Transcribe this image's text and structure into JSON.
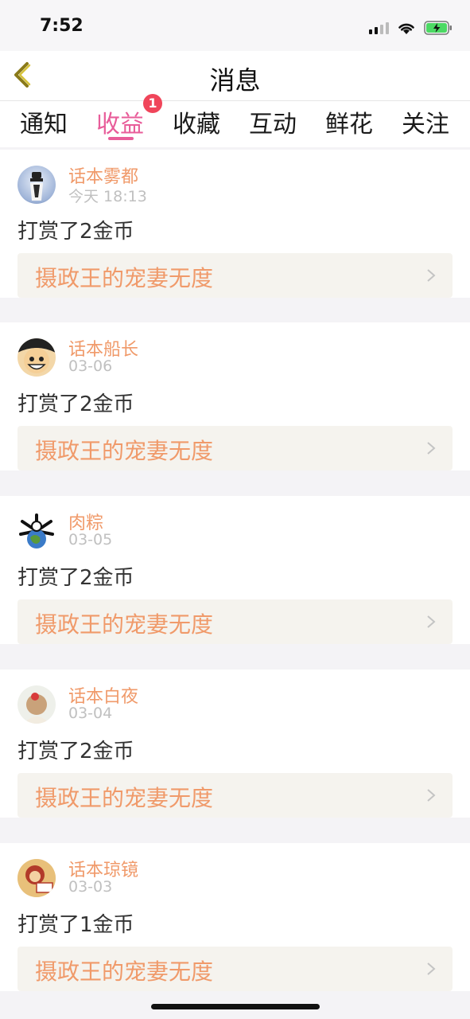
{
  "status": {
    "time": "7:52"
  },
  "nav": {
    "title": "消息"
  },
  "tabs": [
    {
      "label": "通知"
    },
    {
      "label": "收益"
    },
    {
      "label": "收藏"
    },
    {
      "label": "互动"
    },
    {
      "label": "鲜花"
    },
    {
      "label": "关注"
    }
  ],
  "active_tab_badge": "1",
  "colors": {
    "accent": "#e85d9a",
    "name": "#f09a6a",
    "badge": "#f0455a",
    "book_bg": "#f5f3ee"
  },
  "items": [
    {
      "user": "话本雾都",
      "time": "今天 18:13",
      "action": "打赏了2金币",
      "book": "摄政王的宠妻无度",
      "avatar_icon": "avatar-figure-icon"
    },
    {
      "user": "话本船长",
      "time": "03-06",
      "action": "打赏了2金币",
      "book": "摄政王的宠妻无度",
      "avatar_icon": "avatar-cartoon-face-icon"
    },
    {
      "user": "肉粽",
      "time": "03-05",
      "action": "打赏了2金币",
      "book": "摄政王的宠妻无度",
      "avatar_icon": "avatar-earth-icon"
    },
    {
      "user": "话本白夜",
      "time": "03-04",
      "action": "打赏了2金币",
      "book": "摄政王的宠妻无度",
      "avatar_icon": "avatar-girl-icon"
    },
    {
      "user": "话本琼镜",
      "time": "03-03",
      "action": "打赏了1金币",
      "book": "摄政王的宠妻无度",
      "avatar_icon": "avatar-cartoon-icon"
    }
  ]
}
